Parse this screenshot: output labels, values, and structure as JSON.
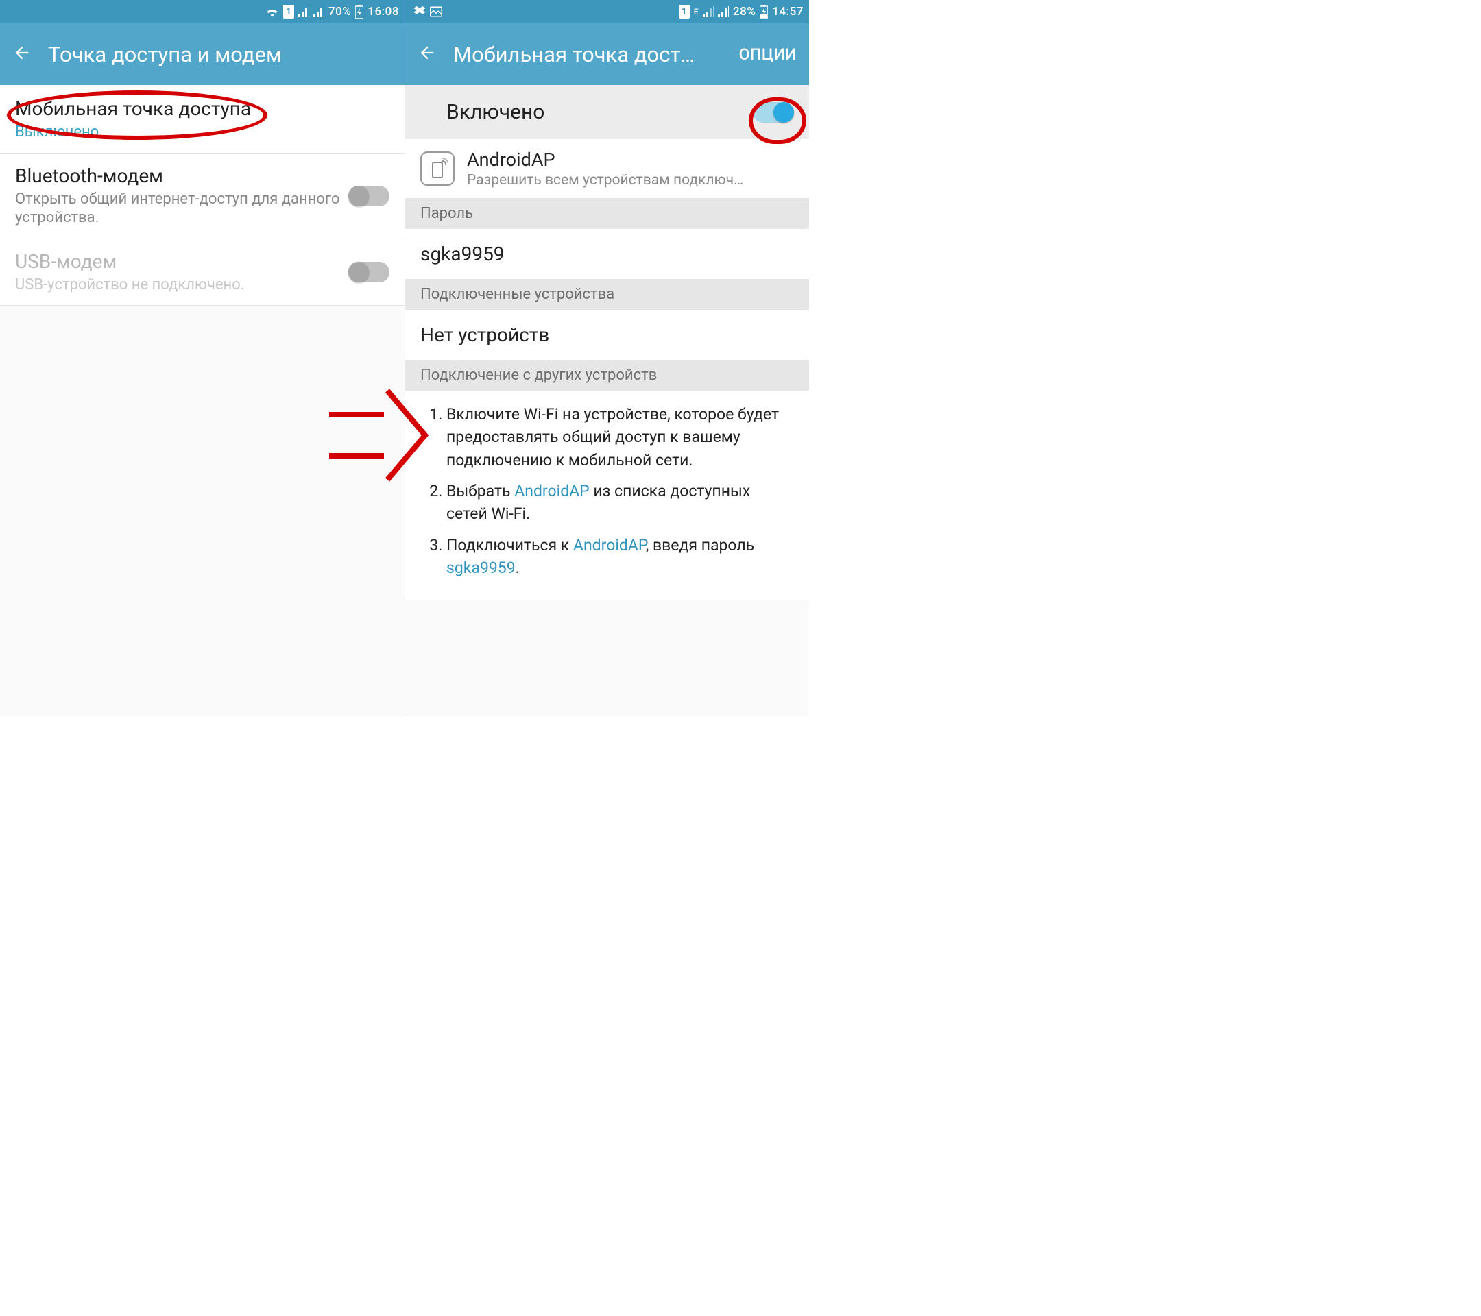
{
  "left": {
    "status": {
      "battery": "70%",
      "time": "16:08",
      "sim": "1"
    },
    "appbar_title": "Точка доступа и модем",
    "items": [
      {
        "title": "Мобильная точка доступа",
        "sub": "Выключено"
      },
      {
        "title": "Bluetooth-модем",
        "sub": "Открыть общий интернет-доступ для данного устройства."
      },
      {
        "title": "USB-модем",
        "sub": "USB-устройство не подключено."
      }
    ]
  },
  "right": {
    "status": {
      "battery": "28%",
      "time": "14:57",
      "sim": "1",
      "net": "E"
    },
    "appbar_title": "Мобильная точка дост…",
    "appbar_options": "ОПЦИИ",
    "enabled_label": "Включено",
    "ap_name": "AndroidAP",
    "ap_desc": "Разрешить всем устройствам подключ…",
    "section_password": "Пароль",
    "password_value": "sgka9959",
    "section_connected": "Подключенные устройства",
    "no_devices": "Нет устройств",
    "section_howto": "Подключение с других устройств",
    "instructions": {
      "step1": "Включите Wi-Fi на устройстве, которое будет предоставлять общий доступ к вашему подключению к мобильной сети.",
      "step2a": "Выбрать ",
      "step2b": " из списка доступных сетей Wi-Fi.",
      "step3a": "Подключиться к ",
      "step3b": ", введя пароль ",
      "step3c": "."
    }
  }
}
